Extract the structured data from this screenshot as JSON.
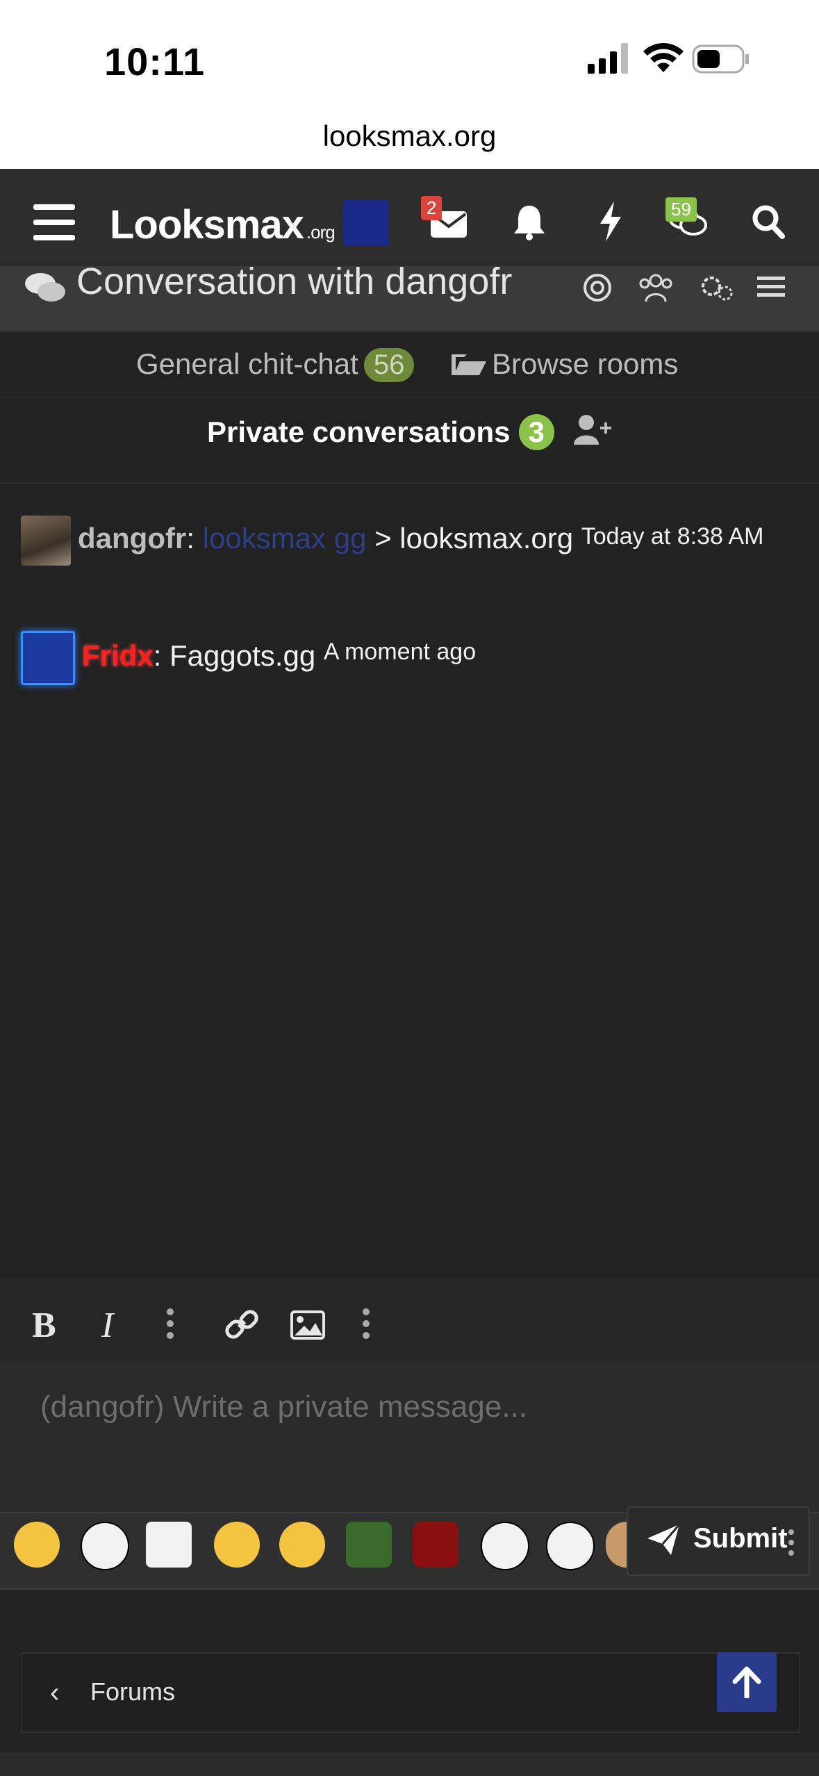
{
  "status_bar": {
    "time": "10:11",
    "url": "looksmax.org"
  },
  "header": {
    "logo_main": "Looksmax",
    "logo_suffix": ".org",
    "mail_badge": "2",
    "chat_badge": "59",
    "badge_colors": {
      "mail": "#d9453c",
      "chat": "#8bc34a"
    }
  },
  "conversation": {
    "title": "Conversation with dangofr"
  },
  "rooms": {
    "general_label": "General chit-chat",
    "general_count": "56",
    "browse_label": "Browse rooms",
    "private_label": "Private conversations",
    "private_count": "3"
  },
  "messages": [
    {
      "user": "dangofr",
      "sep": ":",
      "link_text": "looksmax gg",
      "text": "> looksmax.org",
      "time": "Today at 8:38 AM"
    },
    {
      "user": "Fridx",
      "sep": ":",
      "text": "Faggots.gg",
      "time": "A moment ago"
    }
  ],
  "editor": {
    "placeholder": "(dangofr) Write a private message...",
    "submit_label": "Submit"
  },
  "footer": {
    "forums_label": "Forums"
  }
}
